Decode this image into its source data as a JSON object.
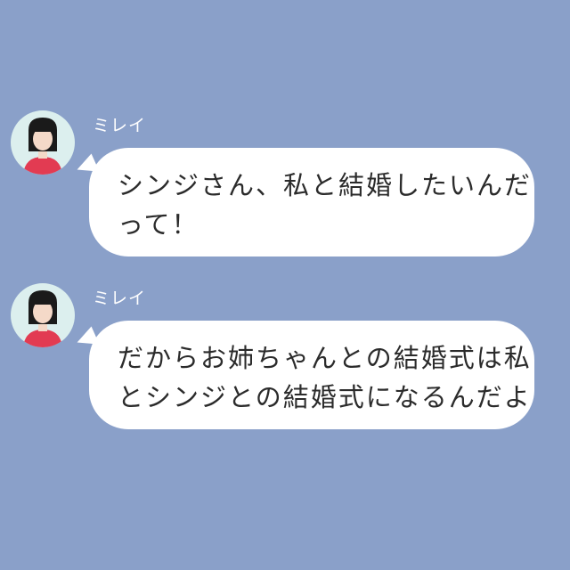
{
  "messages": [
    {
      "sender": "ミレイ",
      "avatar_icon": "girl-avatar-icon",
      "lines": [
        "シンジさん、私と結婚したいんだ",
        "って！"
      ]
    },
    {
      "sender": "ミレイ",
      "avatar_icon": "girl-avatar-icon",
      "lines": [
        "だからお姉ちゃんとの結婚式は私",
        "とシンジとの結婚式になるんだよ"
      ]
    }
  ],
  "colors": {
    "background": "#8aa0c9",
    "bubble": "#ffffff",
    "text": "#2b2b2b",
    "name": "#ffffff",
    "avatar_bg": "#dcefee",
    "avatar_shirt": "#e23b52"
  }
}
